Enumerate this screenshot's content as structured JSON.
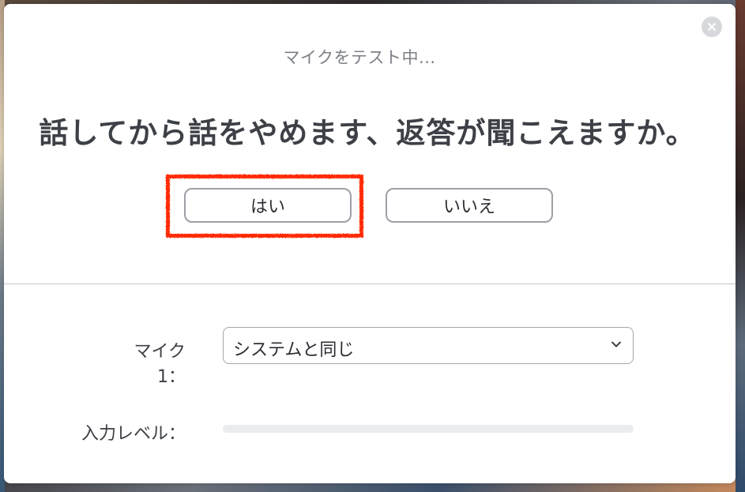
{
  "dialog": {
    "subtitle": "マイクをテスト中...",
    "question": "話してから話をやめます、返答が聞こえますか。",
    "buttons": {
      "yes_label": "はい",
      "no_label": "いいえ"
    },
    "close_icon": "close-icon"
  },
  "settings": {
    "mic_label": "マイク1：",
    "mic_selected": "システムと同じ",
    "level_label": "入力レベル：",
    "input_level": 0
  },
  "colors": {
    "highlight": "#ff2a00",
    "button_border": "#9da0a6",
    "level_track": "#ebecee"
  }
}
